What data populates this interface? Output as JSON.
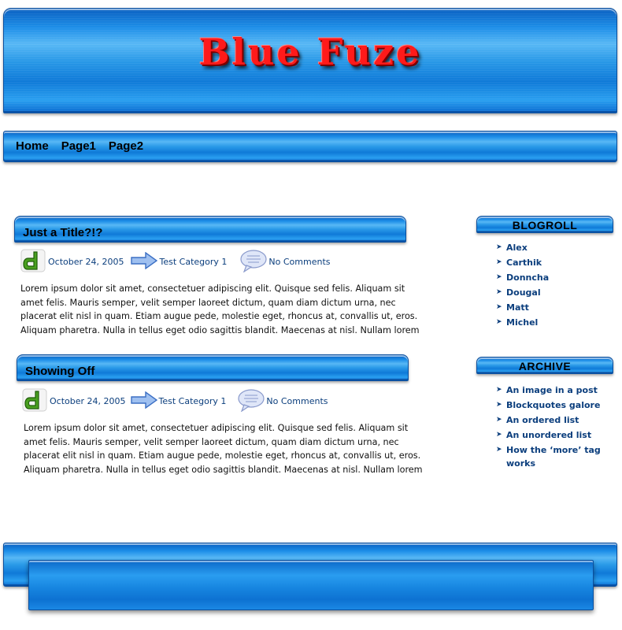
{
  "site": {
    "title": "Blue Fuze"
  },
  "nav": {
    "items": [
      "Home",
      "Page1",
      "Page2"
    ]
  },
  "posts": [
    {
      "title": "Just a Title?!?",
      "date": "October 24, 2005",
      "category": "Test Category 1",
      "comments": "No Comments",
      "body": "Lorem ipsum dolor sit amet, consectetuer adipiscing elit. Quisque sed felis. Aliquam sit amet felis. Mauris semper, velit semper laoreet dictum, quam diam dictum urna, nec placerat elit nisl in quam. Etiam augue pede, molestie eget, rhoncus at, convallis ut, eros. Aliquam pharetra. Nulla in tellus eget odio sagittis blandit. Maecenas at nisl. Nullam lorem"
    },
    {
      "title": "Showing Off",
      "date": "October 24, 2005",
      "category": "Test Category 1",
      "comments": "No Comments",
      "body": "Lorem ipsum dolor sit amet, consectetuer adipiscing elit. Quisque sed felis. Aliquam sit amet felis. Mauris semper, velit semper laoreet dictum, quam diam dictum urna, nec placerat elit nisl in quam. Etiam augue pede, molestie eget, rhoncus at, convallis ut, eros. Aliquam pharetra. Nulla in tellus eget odio sagittis blandit. Maecenas at nisl. Nullam lorem"
    }
  ],
  "sidebar": {
    "blogroll": {
      "title": "BLOGROLL",
      "items": [
        "Alex",
        "Carthik",
        "Donncha",
        "Dougal",
        "Matt",
        "Michel"
      ]
    },
    "archive": {
      "title": "ARCHIVE",
      "items": [
        "An image in a post",
        "Blockquotes galore",
        "An ordered list",
        "An unordered list",
        "How the ‘more’ tag works"
      ]
    }
  },
  "colors": {
    "accent": "#1d8ee8",
    "title_red": "#ff1a1a",
    "link": "#0b3e7d"
  },
  "icons": {
    "post_logo": "d-logo-icon",
    "category": "arrow-right-icon",
    "comments": "speech-bubble-icon",
    "bullet": "chevron-right-icon"
  }
}
